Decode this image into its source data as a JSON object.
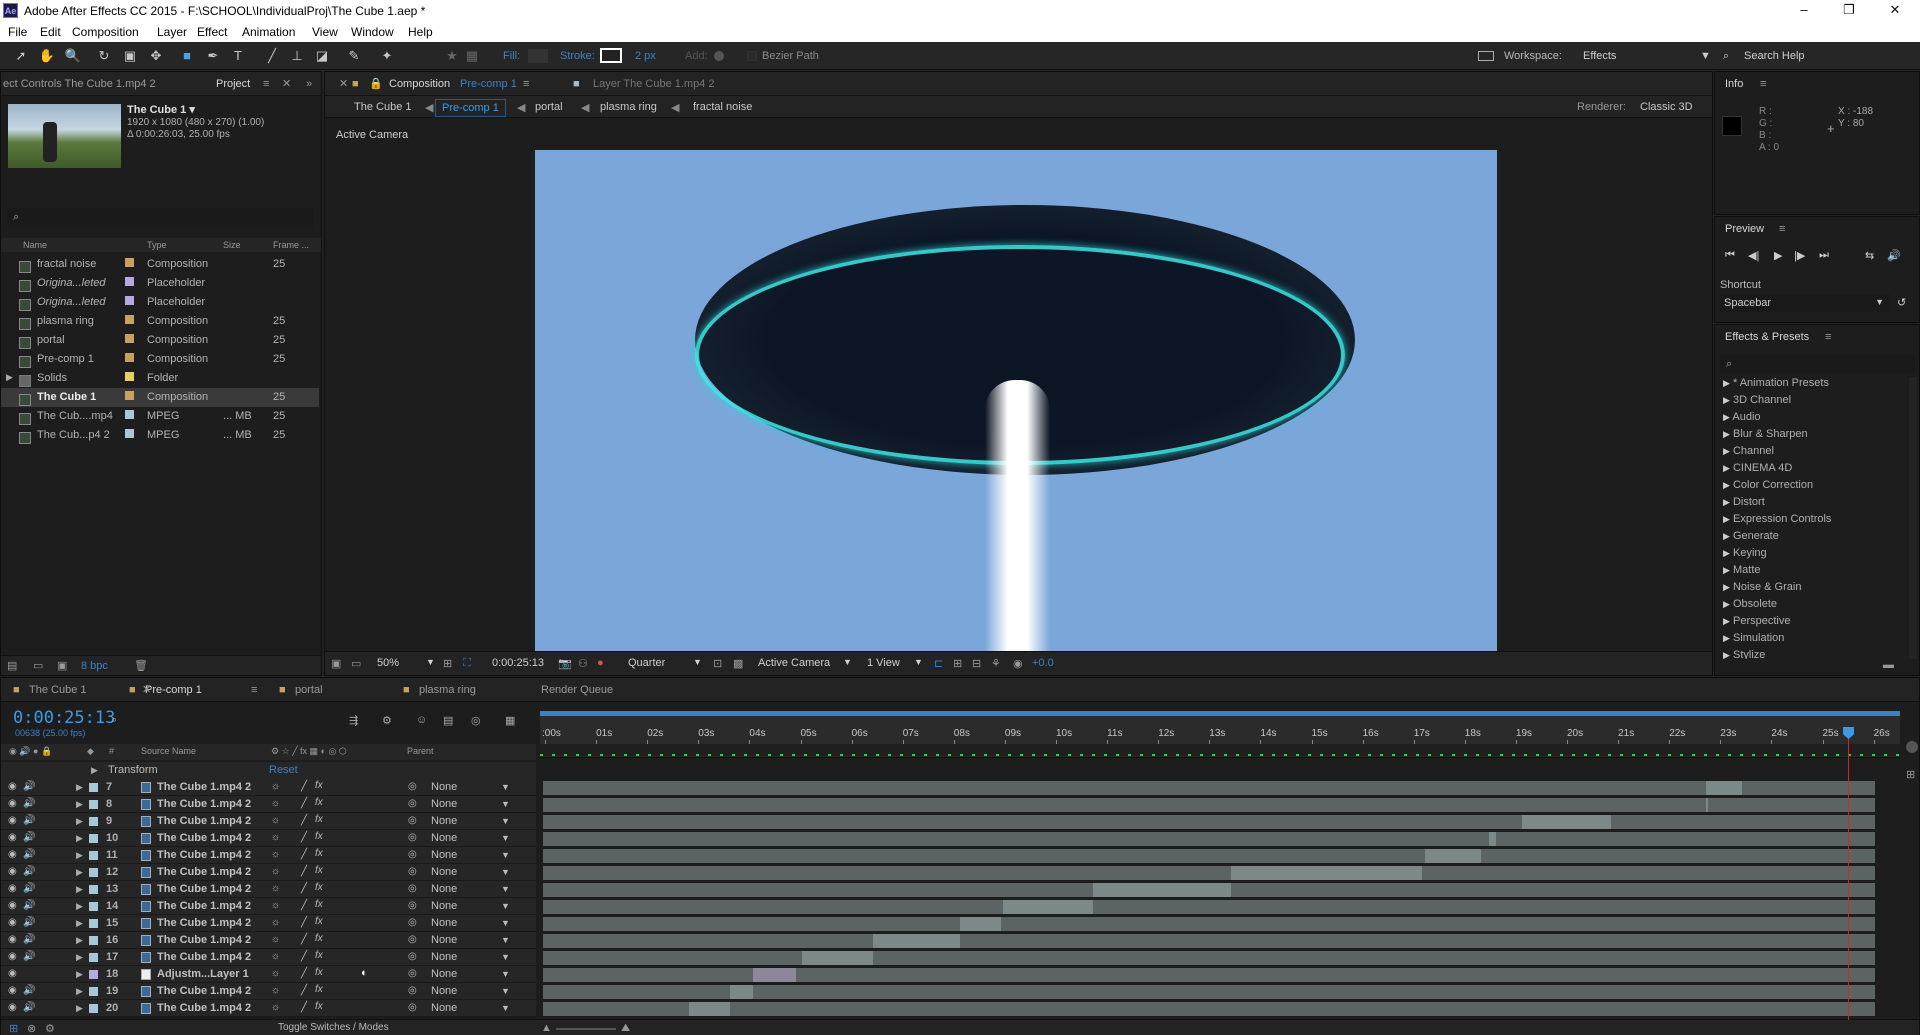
{
  "window": {
    "title": "Adobe After Effects CC 2015 - F:\\SCHOOL\\IndividualProj\\The Cube 1.aep *",
    "app_badge": "Ae",
    "minimize": "–",
    "maximize": "❐",
    "close": "✕"
  },
  "menu": [
    "File",
    "Edit",
    "Composition",
    "Layer",
    "Effect",
    "Animation",
    "View",
    "Window",
    "Help"
  ],
  "toolbar": {
    "fill_label": "Fill:",
    "stroke_label": "Stroke:",
    "stroke_width": "2 px",
    "add_label": "Add:",
    "bezier_label": "Bezier Path",
    "workspace_label": "Workspace:",
    "workspace_value": "Effects",
    "search_help": "Search Help"
  },
  "project": {
    "tab_effect_controls": "ect Controls  The Cube 1.mp4 2",
    "tab_project": "Project",
    "item_name": "The Cube 1 ▾",
    "item_res": "1920 x 1080  (480 x 270) (1.00)",
    "item_dur": "Δ 0:00:26:03, 25.00 fps",
    "cols": {
      "name": "Name",
      "type": "Type",
      "size": "Size",
      "frame": "Frame ..."
    },
    "rows": [
      {
        "name": "fractal noise",
        "type": "Composition",
        "size": "",
        "fps": "25",
        "color": "#c8a060"
      },
      {
        "name": "Origina...leted",
        "type": "Placeholder",
        "size": "",
        "fps": "",
        "color": "#b8a8e0"
      },
      {
        "name": "Origina...leted",
        "type": "Placeholder",
        "size": "",
        "fps": "",
        "color": "#b8a8e0"
      },
      {
        "name": "plasma ring",
        "type": "Composition",
        "size": "",
        "fps": "25",
        "color": "#c8a060"
      },
      {
        "name": "portal",
        "type": "Composition",
        "size": "",
        "fps": "25",
        "color": "#c8a060"
      },
      {
        "name": "Pre-comp 1",
        "type": "Composition",
        "size": "",
        "fps": "25",
        "color": "#c8a060"
      },
      {
        "name": "Solids",
        "type": "Folder",
        "size": "",
        "fps": "",
        "color": "#e8d060"
      },
      {
        "name": "The Cube 1",
        "type": "Composition",
        "size": "",
        "fps": "25",
        "color": "#c8a060"
      },
      {
        "name": "The Cub....mp4",
        "type": "MPEG",
        "size": "... MB",
        "fps": "25",
        "color": "#a8c8d8"
      },
      {
        "name": "The Cub...p4 2",
        "type": "MPEG",
        "size": "... MB",
        "fps": "25",
        "color": "#a8c8d8"
      }
    ],
    "bpc": "8 bpc"
  },
  "composition": {
    "tab_label": "Composition",
    "tab_comp": "Pre-comp 1",
    "layer_tab": "Layer  The Cube 1.mp4 2",
    "breadcrumbs": [
      "The Cube 1",
      "Pre-comp 1",
      "portal",
      "plasma ring",
      "fractal noise"
    ],
    "renderer_label": "Renderer:",
    "renderer_value": "Classic 3D",
    "active_camera": "Active Camera",
    "zoom": "50%",
    "timecode": "0:00:25:13",
    "quality": "Quarter",
    "camera_select": "Active Camera",
    "view_select": "1 View",
    "exposure": "+0.0"
  },
  "info": {
    "title": "Info",
    "r": "R :",
    "g": "G :",
    "b": "B :",
    "a": "A : 0",
    "x": "X : -188",
    "y": "Y : 80"
  },
  "preview": {
    "title": "Preview",
    "shortcut_label": "Shortcut",
    "shortcut_value": "Spacebar"
  },
  "effects": {
    "title": "Effects & Presets",
    "items": [
      "* Animation Presets",
      "3D Channel",
      "Audio",
      "Blur & Sharpen",
      "Channel",
      "CINEMA 4D",
      "Color Correction",
      "Distort",
      "Expression Controls",
      "Generate",
      "Keying",
      "Matte",
      "Noise & Grain",
      "Obsolete",
      "Perspective",
      "Simulation",
      "Stylize"
    ]
  },
  "timeline": {
    "tabs": [
      "The Cube 1",
      "Pre-comp 1",
      "portal",
      "plasma ring",
      "Render Queue"
    ],
    "timecode": "0:00:25:13",
    "frames": "00638 (25.00 fps)",
    "col_source": "Source Name",
    "col_parent": "Parent",
    "transform": "Transform",
    "reset": "Reset",
    "ticks": [
      ":00s",
      "01s",
      "02s",
      "03s",
      "04s",
      "05s",
      "06s",
      "07s",
      "08s",
      "09s",
      "10s",
      "11s",
      "12s",
      "13s",
      "14s",
      "15s",
      "16s",
      "17s",
      "18s",
      "19s",
      "20s",
      "21s",
      "22s",
      "23s",
      "24s",
      "25s",
      "26s"
    ],
    "playhead_sec": 25.5,
    "toggle_label": "Toggle Switches / Modes",
    "layers": [
      {
        "num": "7",
        "name": "The Cube 1.mp4 2",
        "parent": "None",
        "start": 22.7,
        "end": 23.4,
        "adj": false
      },
      {
        "num": "8",
        "name": "The Cube 1.mp4 2",
        "parent": "None",
        "start": 22.7,
        "end": 22.72,
        "adj": false
      },
      {
        "num": "9",
        "name": "The Cube 1.mp4 2",
        "parent": "None",
        "start": 19.1,
        "end": 20.85,
        "adj": false
      },
      {
        "num": "10",
        "name": "The Cube 1.mp4 2",
        "parent": "None",
        "start": 18.45,
        "end": 18.6,
        "adj": false
      },
      {
        "num": "11",
        "name": "The Cube 1.mp4 2",
        "parent": "None",
        "start": 17.2,
        "end": 18.3,
        "adj": false
      },
      {
        "num": "12",
        "name": "The Cube 1.mp4 2",
        "parent": "None",
        "start": 13.4,
        "end": 17.15,
        "adj": false
      },
      {
        "num": "13",
        "name": "The Cube 1.mp4 2",
        "parent": "None",
        "start": 10.7,
        "end": 13.4,
        "adj": false
      },
      {
        "num": "14",
        "name": "The Cube 1.mp4 2",
        "parent": "None",
        "start": 8.95,
        "end": 10.7,
        "adj": false
      },
      {
        "num": "15",
        "name": "The Cube 1.mp4 2",
        "parent": "None",
        "start": 8.1,
        "end": 8.9,
        "adj": false
      },
      {
        "num": "16",
        "name": "The Cube 1.mp4 2",
        "parent": "None",
        "start": 6.4,
        "end": 8.1,
        "adj": false
      },
      {
        "num": "17",
        "name": "The Cube 1.mp4 2",
        "parent": "None",
        "start": 5.0,
        "end": 6.4,
        "adj": false
      },
      {
        "num": "18",
        "name": "Adjustm...Layer 1",
        "parent": "None",
        "start": 4.05,
        "end": 4.9,
        "adj": true
      },
      {
        "num": "19",
        "name": "The Cube 1.mp4 2",
        "parent": "None",
        "start": 3.6,
        "end": 4.05,
        "adj": false
      },
      {
        "num": "20",
        "name": "The Cube 1.mp4 2",
        "parent": "None",
        "start": 2.8,
        "end": 3.6,
        "adj": false
      }
    ]
  }
}
